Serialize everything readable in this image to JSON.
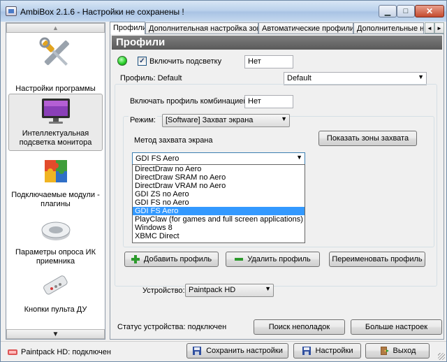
{
  "window": {
    "title": "AmbiBox 2.1.6  - Настройки не сохранены !",
    "minimize_glyph": "▁",
    "maximize_glyph": "□",
    "close_glyph": "✕"
  },
  "sidebar": {
    "up_glyph": "▲",
    "down_glyph": "▼",
    "items": [
      {
        "label": "Настройки программы",
        "icon": "wrench-screwdriver-icon"
      },
      {
        "label": "Интеллектуальная подсветка монитора",
        "icon": "monitor-icon"
      },
      {
        "label": "Подключаемые модули - плагины",
        "icon": "puzzle-icon"
      },
      {
        "label": "Параметры опроса ИК приемника",
        "icon": "ir-receiver-icon"
      },
      {
        "label": "Кнопки пульта ДУ",
        "icon": "remote-control-icon"
      }
    ]
  },
  "tabs": [
    {
      "label": "Профили",
      "active": true
    },
    {
      "label": "Дополнительная настройка зон",
      "active": false
    },
    {
      "label": "Автоматические профили",
      "active": false
    },
    {
      "label": "Дополнительные н",
      "active": false
    }
  ],
  "tab_scroll": {
    "left": "◄",
    "right": "►"
  },
  "panel": {
    "header": "Профили",
    "enable_backlight": {
      "label": "Включить подсветку",
      "checked": true,
      "check_glyph": "✓",
      "hotkey_value": "Нет"
    },
    "profile_label": "Профиль: Default",
    "profile_select": "Default",
    "combo_label": "Включать профиль комбинацией:",
    "combo_value": "Нет",
    "mode_label": "Режим:",
    "mode_value": "[Software] Захват экрана",
    "capture_method_label": "Метод захвата экрана",
    "show_zones_button": "Показать зоны захвата",
    "capture_method_value": "GDI FS Aero",
    "capture_options": [
      "DirectDraw no Aero",
      "DirectDraw SRAM no Aero",
      "DirectDraw VRAM no Aero",
      "GDI ZS no Aero",
      "GDI FS no Aero",
      "GDI FS Aero",
      "PlayClaw (for games and full screen applications)",
      "Windows 8",
      "XBMC Direct"
    ],
    "capture_selected_index": 5,
    "add_profile_button": "Добавить профиль",
    "delete_profile_button": "Удалить профиль",
    "rename_profile_button": "Переименовать профиль",
    "device_label": "Устройство:",
    "device_value": "Paintpack HD",
    "device_status": "Статус устройства: подключен",
    "troubleshoot_button": "Поиск неполадок",
    "more_settings_button": "Больше настроек"
  },
  "statusbar": {
    "device_status": "Paintpack HD: подключен",
    "save_button": "Сохранить настройки",
    "settings_button": "Настройки",
    "exit_button": "Выход"
  },
  "colors": {
    "selection": "#3399ff",
    "header_bg": "#6b6b6b",
    "led_green": "#2bd12b"
  }
}
